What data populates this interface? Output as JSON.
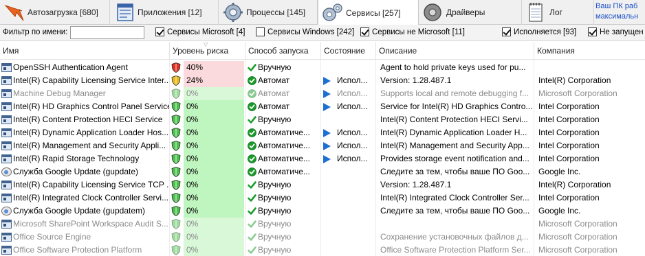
{
  "tabs": [
    {
      "label": "Автозагрузка [680]",
      "icon": "startup-icon"
    },
    {
      "label": "Приложения [12]",
      "icon": "applications-icon"
    },
    {
      "label": "Процессы [145]",
      "icon": "processes-gear-icon"
    },
    {
      "label": "Сервисы [257]",
      "icon": "services-gears-icon",
      "active": true
    },
    {
      "label": "Драйверы",
      "icon": "drivers-icon"
    },
    {
      "label": "Лог",
      "icon": "log-notepad-icon"
    }
  ],
  "promo": {
    "line1": "Ваш ПК раб",
    "line2": "максимальн"
  },
  "filter": {
    "label": "Фильтр по имени:",
    "value": "",
    "checks": [
      {
        "label": "Сервисы Microsoft [4]",
        "checked": true
      },
      {
        "label": "Сервисы Windows [242]",
        "checked": false
      },
      {
        "label": "Сервисы не Microsoft [11]",
        "checked": true
      },
      {
        "label": "Исполняется [93]",
        "checked": true
      },
      {
        "label": "Не запущен [",
        "checked": true
      }
    ]
  },
  "columns": {
    "name": "Имя",
    "risk": "Уровень риска",
    "start": "Способ запуска",
    "state": "Состояние",
    "desc": "Описание",
    "company": "Компания"
  },
  "colors": {
    "risk_high": "#fadadd",
    "risk_low": "#bff5bf",
    "risk_low_dim": "#d8f8d8",
    "shield_red": "#e03020",
    "shield_yellow": "#e8b820",
    "shield_green": "#4cc04c",
    "running_arrow": "#1f6fd1"
  },
  "rows": [
    {
      "name": "OpenSSH Authentication Agent",
      "icon": "service",
      "risk": "40%",
      "level": "high",
      "shield": "red",
      "start": "Вручную",
      "startIcon": "check",
      "state": "",
      "desc": "Agent to hold private keys used for pu...",
      "company": "",
      "disabled": false
    },
    {
      "name": "Intel(R) Capability Licensing Service Inter...",
      "icon": "service",
      "risk": "24%",
      "level": "high",
      "shield": "yellow",
      "start": "Автомат",
      "startIcon": "check-circle",
      "state": "Испол...",
      "desc": "Version: 1.28.487.1",
      "company": "Intel(R) Corporation",
      "disabled": false
    },
    {
      "name": "Machine Debug Manager",
      "icon": "service",
      "risk": "0%",
      "level": "low",
      "shield": "green",
      "start": "Автомат",
      "startIcon": "check-circle",
      "state": "Испол...",
      "desc": "Supports local and remote debugging f...",
      "company": "Microsoft Corporation",
      "disabled": true
    },
    {
      "name": "Intel(R) HD Graphics Control Panel Service",
      "icon": "service",
      "risk": "0%",
      "level": "low",
      "shield": "green",
      "start": "Автомат",
      "startIcon": "check-circle",
      "state": "Испол...",
      "desc": "Service for Intel(R) HD Graphics Contro...",
      "company": "Intel Corporation",
      "disabled": false
    },
    {
      "name": "Intel(R) Content Protection HECI Service",
      "icon": "service",
      "risk": "0%",
      "level": "low",
      "shield": "green",
      "start": "Вручную",
      "startIcon": "check",
      "state": "",
      "desc": "Intel(R) Content Protection HECI Servi...",
      "company": "Intel Corporation",
      "disabled": false
    },
    {
      "name": "Intel(R) Dynamic Application Loader Hos...",
      "icon": "service",
      "risk": "0%",
      "level": "low",
      "shield": "green",
      "start": "Автоматиче...",
      "startIcon": "check-circle",
      "state": "Испол...",
      "desc": "Intel(R) Dynamic Application Loader H...",
      "company": "Intel Corporation",
      "disabled": false
    },
    {
      "name": "Intel(R) Management and Security Appli...",
      "icon": "service",
      "risk": "0%",
      "level": "low",
      "shield": "green",
      "start": "Автоматиче...",
      "startIcon": "check-circle",
      "state": "Испол...",
      "desc": "Intel(R) Management and Security App...",
      "company": "Intel Corporation",
      "disabled": false
    },
    {
      "name": "Intel(R) Rapid Storage Technology",
      "icon": "service",
      "risk": "0%",
      "level": "low",
      "shield": "green",
      "start": "Автоматиче...",
      "startIcon": "check-circle",
      "state": "Испол...",
      "desc": "Provides storage event notification and...",
      "company": "Intel Corporation",
      "disabled": false
    },
    {
      "name": "Служба Google Update (gupdate)",
      "icon": "google",
      "risk": "0%",
      "level": "low",
      "shield": "green",
      "start": "Автоматиче...",
      "startIcon": "check-circle",
      "state": "",
      "desc": "Следите за тем, чтобы ваше ПО Goo...",
      "company": "Google Inc.",
      "disabled": false
    },
    {
      "name": "Intel(R) Capability Licensing Service TCP ...",
      "icon": "service",
      "risk": "0%",
      "level": "low",
      "shield": "green",
      "start": "Вручную",
      "startIcon": "check",
      "state": "",
      "desc": "Version: 1.28.487.1",
      "company": "Intel(R) Corporation",
      "disabled": false
    },
    {
      "name": "Intel(R) Integrated Clock Controller Servi...",
      "icon": "service",
      "risk": "0%",
      "level": "low",
      "shield": "green",
      "start": "Вручную",
      "startIcon": "check",
      "state": "",
      "desc": "Intel(R) Integrated Clock Controller Ser...",
      "company": "Intel Corporation",
      "disabled": false
    },
    {
      "name": "Служба Google Update (gupdatem)",
      "icon": "google",
      "risk": "0%",
      "level": "low",
      "shield": "green",
      "start": "Вручную",
      "startIcon": "check",
      "state": "",
      "desc": "Следите за тем, чтобы ваше ПО Goo...",
      "company": "Google Inc.",
      "disabled": false
    },
    {
      "name": "Microsoft SharePoint Workspace Audit S...",
      "icon": "service",
      "risk": "0%",
      "level": "low",
      "shield": "green",
      "start": "Вручную",
      "startIcon": "check",
      "state": "",
      "desc": "",
      "company": "Microsoft Corporation",
      "disabled": true
    },
    {
      "name": "Office  Source Engine",
      "icon": "service",
      "risk": "0%",
      "level": "low",
      "shield": "green",
      "start": "Вручную",
      "startIcon": "check",
      "state": "",
      "desc": "Сохранение установочных файлов д...",
      "company": "Microsoft Corporation",
      "disabled": true
    },
    {
      "name": "Office Software Protection Platform",
      "icon": "service",
      "risk": "0%",
      "level": "low",
      "shield": "green",
      "start": "Вручную",
      "startIcon": "check",
      "state": "",
      "desc": "Office Software Protection Platform Ser...",
      "company": "Microsoft Corporation",
      "disabled": true
    }
  ]
}
